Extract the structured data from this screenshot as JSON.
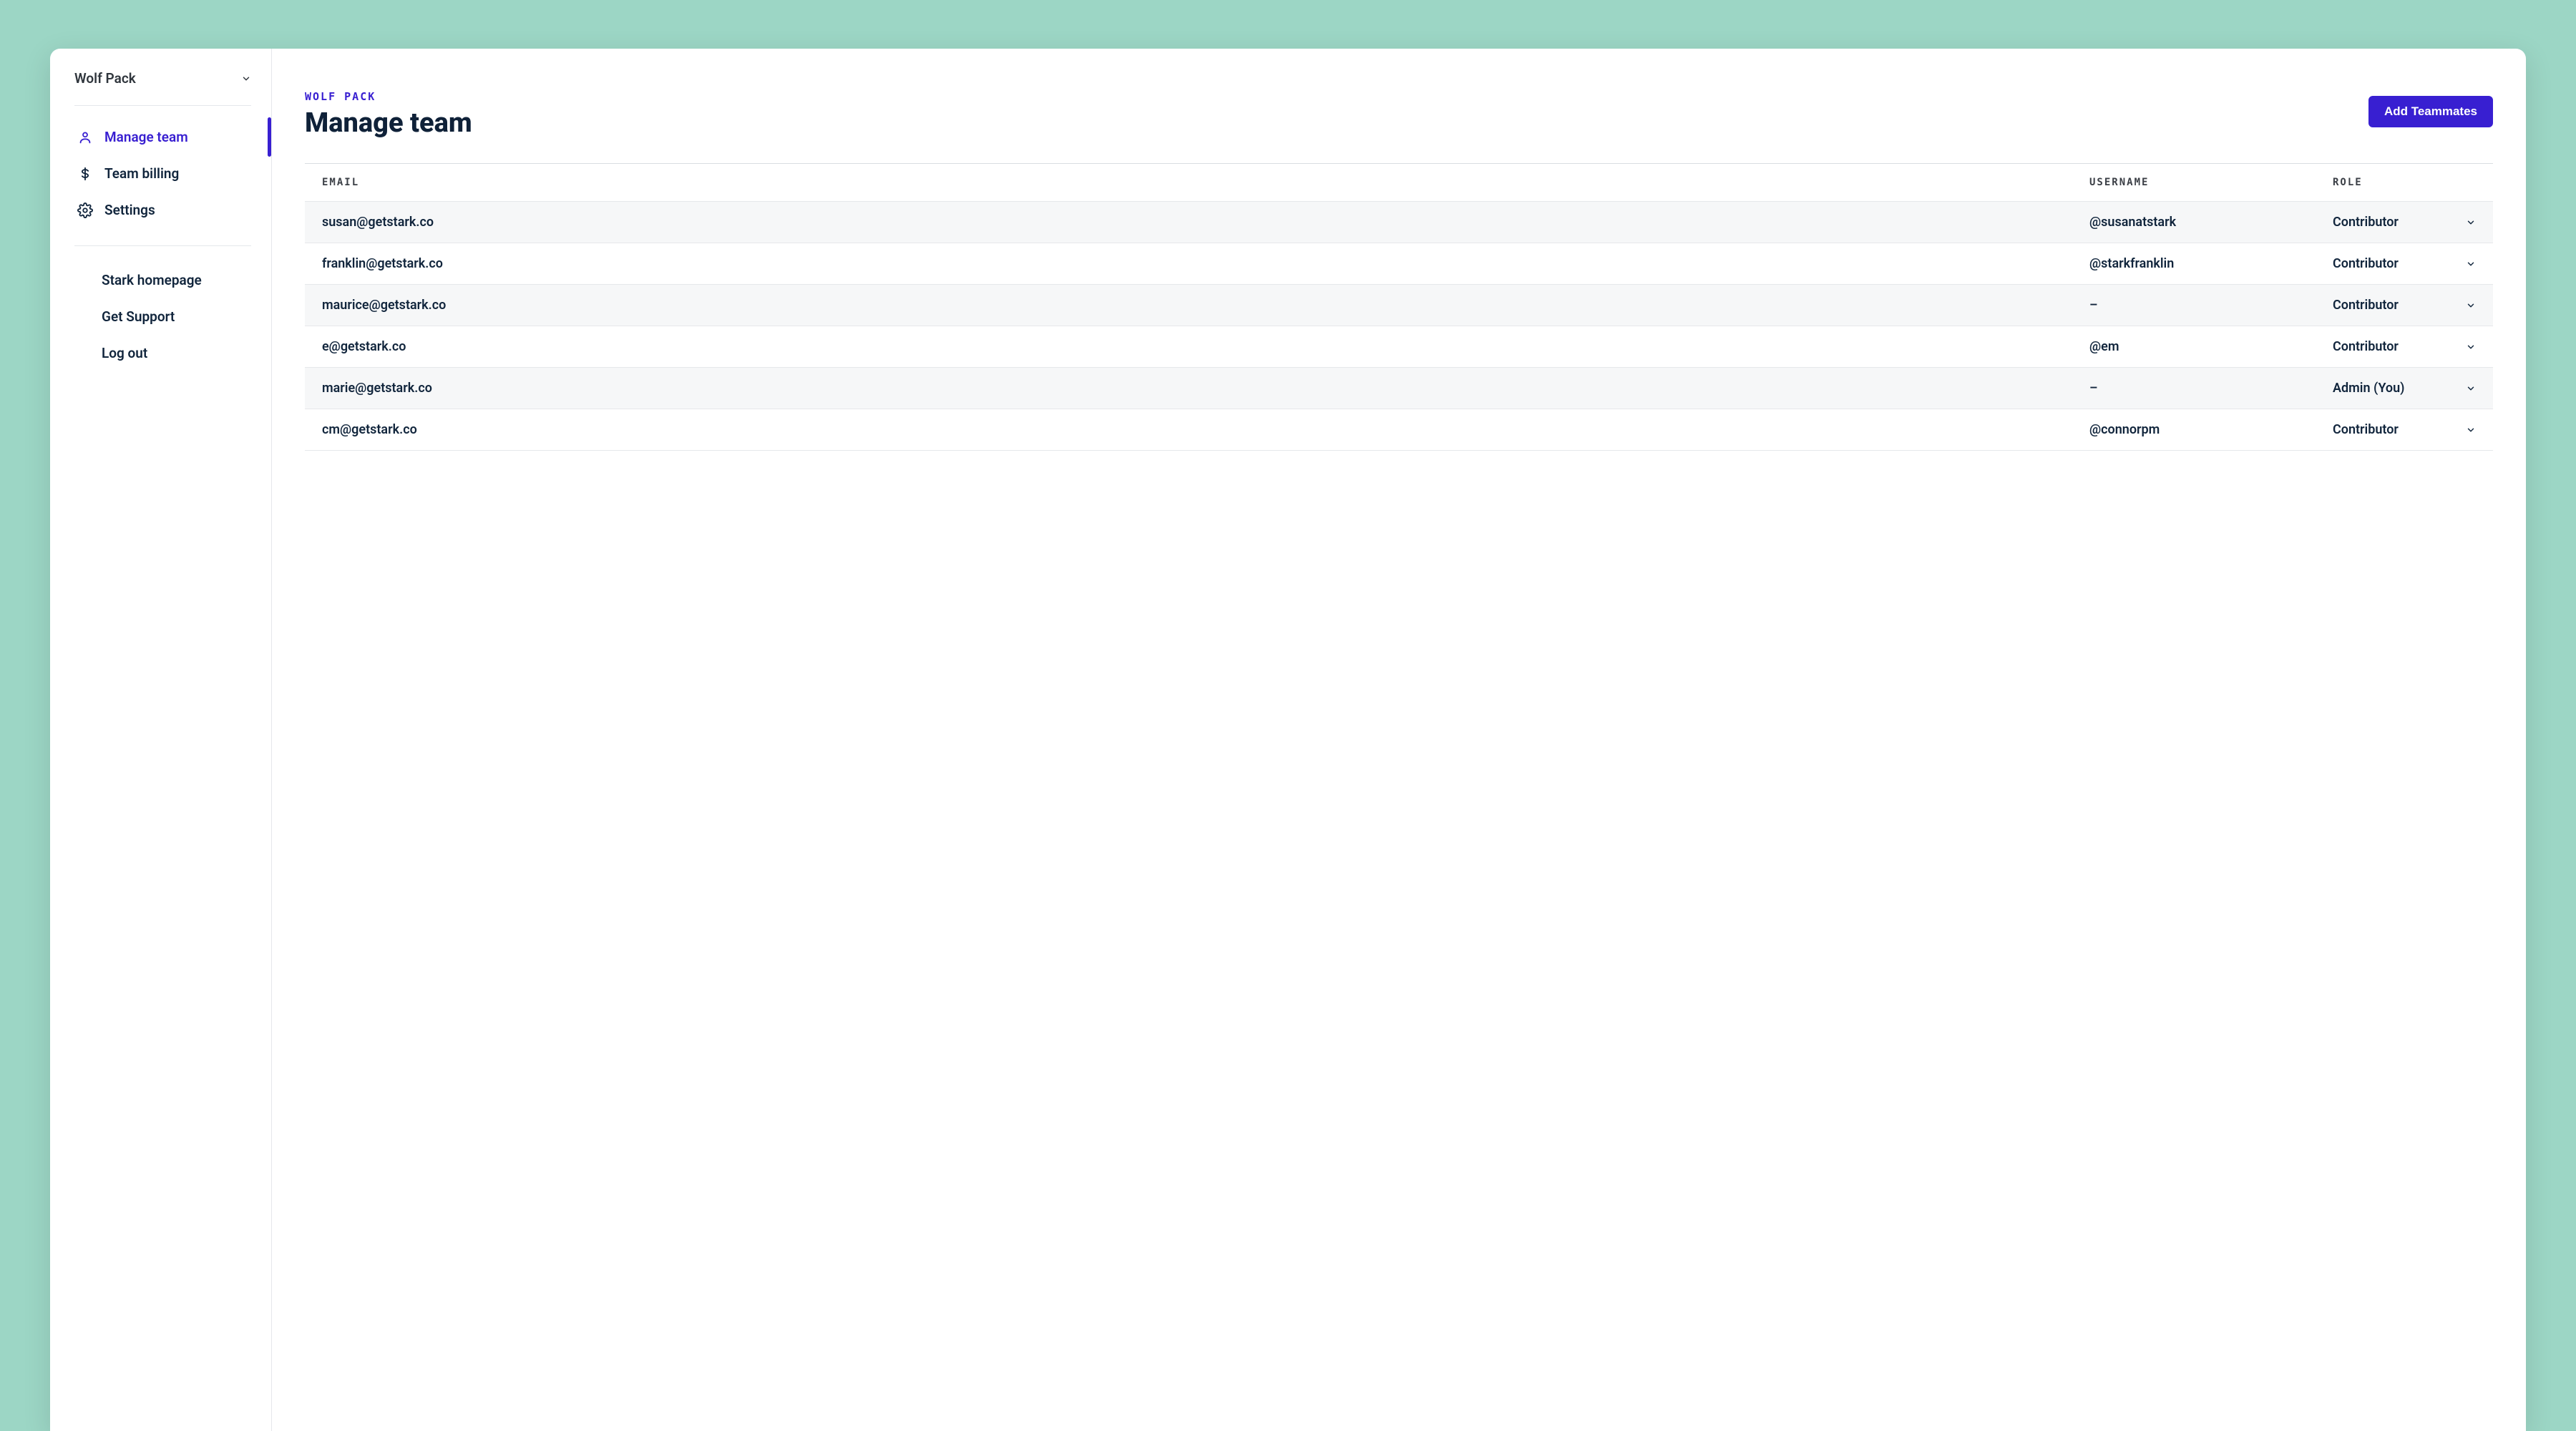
{
  "sidebar": {
    "team_name": "Wolf Pack",
    "nav": [
      {
        "label": "Manage team"
      },
      {
        "label": "Team billing"
      },
      {
        "label": "Settings"
      }
    ],
    "links": [
      {
        "label": "Stark homepage"
      },
      {
        "label": "Get Support"
      },
      {
        "label": "Log out"
      }
    ]
  },
  "header": {
    "breadcrumb": "WOLF PACK",
    "title": "Manage team",
    "add_button": "Add Teammates"
  },
  "table": {
    "columns": {
      "email": "EMAIL",
      "username": "USERNAME",
      "role": "ROLE"
    },
    "rows": [
      {
        "email": "susan@getstark.co",
        "username": "@susanatstark",
        "role": "Contributor"
      },
      {
        "email": "franklin@getstark.co",
        "username": "@starkfranklin",
        "role": "Contributor"
      },
      {
        "email": "maurice@getstark.co",
        "username": "–",
        "role": "Contributor"
      },
      {
        "email": "e@getstark.co",
        "username": "@em",
        "role": "Contributor"
      },
      {
        "email": "marie@getstark.co",
        "username": "–",
        "role": "Admin (You)"
      },
      {
        "email": "cm@getstark.co",
        "username": "@connorpm",
        "role": "Contributor"
      }
    ]
  }
}
